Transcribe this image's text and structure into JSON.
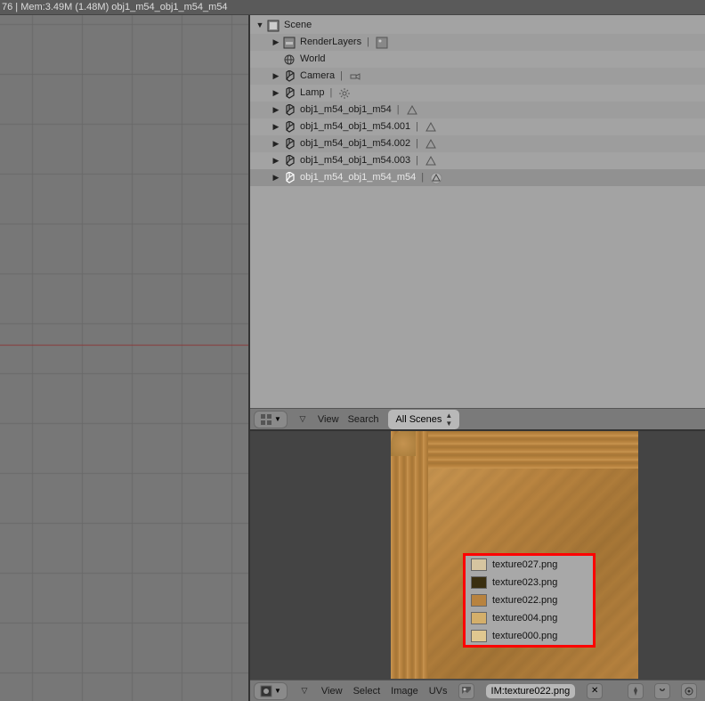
{
  "header": {
    "info": "76 | Mem:3.49M (1.48M) obj1_m54_obj1_m54_m54"
  },
  "outliner": {
    "root": "Scene",
    "items": [
      {
        "label": "RenderLayers",
        "icon": "layers",
        "depth": 1,
        "selected": false,
        "extra": "image"
      },
      {
        "label": "World",
        "icon": "world",
        "depth": 1,
        "selected": false,
        "extra": ""
      },
      {
        "label": "Camera",
        "icon": "object",
        "depth": 1,
        "selected": false,
        "extra": "camera"
      },
      {
        "label": "Lamp",
        "icon": "object",
        "depth": 1,
        "selected": false,
        "extra": "lamp"
      },
      {
        "label": "obj1_m54_obj1_m54",
        "icon": "object",
        "depth": 1,
        "selected": false,
        "extra": "mesh"
      },
      {
        "label": "obj1_m54_obj1_m54.001",
        "icon": "object",
        "depth": 1,
        "selected": false,
        "extra": "mesh"
      },
      {
        "label": "obj1_m54_obj1_m54.002",
        "icon": "object",
        "depth": 1,
        "selected": false,
        "extra": "mesh"
      },
      {
        "label": "obj1_m54_obj1_m54.003",
        "icon": "object",
        "depth": 1,
        "selected": false,
        "extra": "mesh"
      },
      {
        "label": "obj1_m54_obj1_m54_m54",
        "icon": "object",
        "depth": 1,
        "selected": true,
        "extra": "mesh-sel"
      }
    ],
    "footer": {
      "view": "View",
      "search": "Search",
      "filter": "All Scenes"
    }
  },
  "imageEditor": {
    "currentImage": "IM:texture022.png",
    "popup": [
      {
        "name": "texture027.png",
        "swatch": "#d6c5a0"
      },
      {
        "name": "texture023.png",
        "swatch": "#3a2f10"
      },
      {
        "name": "texture022.png",
        "swatch": "#b8833f"
      },
      {
        "name": "texture004.png",
        "swatch": "#d4af6a"
      },
      {
        "name": "texture000.png",
        "swatch": "#e0c890"
      }
    ],
    "footer": {
      "view": "View",
      "select": "Select",
      "image": "Image",
      "uvs": "UVs"
    }
  },
  "icons": {
    "scene": "scene-icon",
    "renderlayers": "layers-icon",
    "world": "world-icon",
    "object": "object-icon",
    "camera": "camera-icon",
    "lamp": "lamp-icon",
    "mesh": "mesh-icon"
  }
}
